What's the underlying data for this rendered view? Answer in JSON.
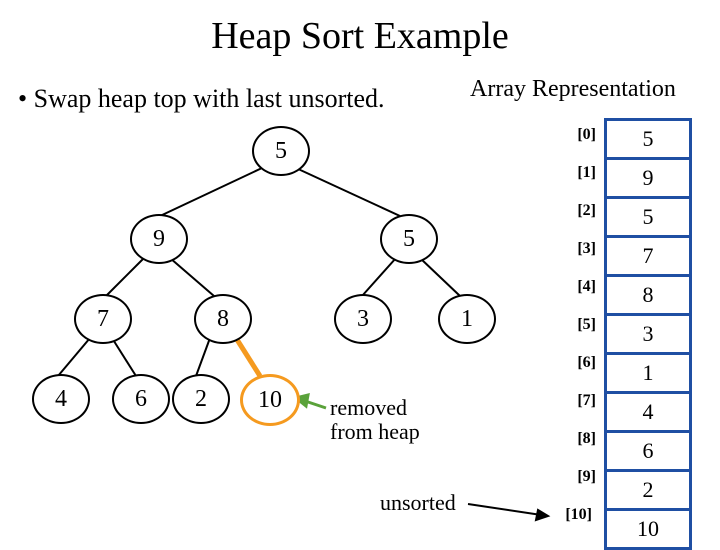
{
  "title": "Heap Sort Example",
  "bullet": "• Swap heap top with last unsorted.",
  "array_label": "Array Representation",
  "indices": [
    "[0]",
    "[1]",
    "[2]",
    "[3]",
    "[4]",
    "[5]",
    "[6]",
    "[7]",
    "[8]",
    "[9]",
    "[10]"
  ],
  "values": [
    "5",
    "9",
    "5",
    "7",
    "8",
    "3",
    "1",
    "4",
    "6",
    "2",
    "10"
  ],
  "nodes": {
    "n0": "5",
    "n1": "9",
    "n2": "5",
    "n3": "7",
    "n4": "8",
    "n5": "3",
    "n6": "1",
    "n7": "4",
    "n8": "6",
    "n9": "2",
    "n10": "10"
  },
  "annot": {
    "removed": "removed\nfrom heap",
    "unsorted": "unsorted"
  },
  "chart_data": {
    "type": "table",
    "title": "Heap Sort Example — tree and array representation after swap",
    "series": [
      {
        "name": "array_index",
        "values": [
          0,
          1,
          2,
          3,
          4,
          5,
          6,
          7,
          8,
          9,
          10
        ]
      },
      {
        "name": "array_value",
        "values": [
          5,
          9,
          5,
          7,
          8,
          3,
          1,
          4,
          6,
          2,
          10
        ]
      }
    ],
    "tree_edges": [
      [
        0,
        1
      ],
      [
        0,
        2
      ],
      [
        1,
        3
      ],
      [
        1,
        4
      ],
      [
        2,
        5
      ],
      [
        2,
        6
      ],
      [
        3,
        7
      ],
      [
        3,
        8
      ],
      [
        4,
        9
      ],
      [
        4,
        10
      ]
    ],
    "removed_node_index": 10,
    "unsorted_node_index": 10
  }
}
